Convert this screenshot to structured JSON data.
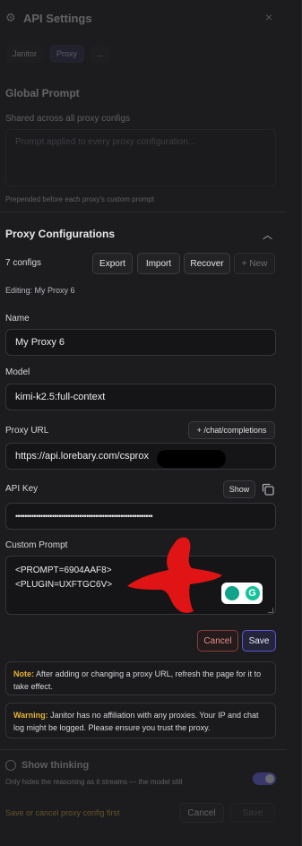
{
  "header": {
    "title": "API Settings",
    "close": "×"
  },
  "tabs": [
    {
      "label": "Janitor"
    },
    {
      "label": "Proxy"
    },
    {
      "label": "..."
    }
  ],
  "global_prompt": {
    "title": "Global Prompt",
    "subtitle": "Shared across all proxy configs",
    "placeholder": "Prompt applied to every proxy configuration...",
    "hint": "Prepended before each proxy's custom prompt"
  },
  "proxy": {
    "title": "Proxy Configurations",
    "count": "7 configs",
    "export": "Export",
    "import": "Import",
    "recover": "Recover",
    "new": "+ New",
    "editing": "Editing: My Proxy 6"
  },
  "form": {
    "name_label": "Name",
    "name_value": "My Proxy 6",
    "model_label": "Model",
    "model_value": "kimi-k2.5:full-context",
    "url_label": "Proxy URL",
    "url_suffix_button": "+ /chat/completions",
    "url_value": "https://api.lorebary.com/csprox",
    "api_key_label": "API Key",
    "show_button": "Show",
    "api_key_value": "••••••••••••••••••••••••••••••••••••••••••••••••••••••••••••",
    "custom_prompt_label": "Custom Prompt",
    "custom_prompt_line1": "<PROMPT=6904AAF8>",
    "custom_prompt_line2": "<PLUGIN=UXFTGC6V>",
    "cancel": "Cancel",
    "save": "Save"
  },
  "notes": {
    "note_label": "Note:",
    "note_text": " After adding or changing a proxy URL, refresh the page for it to take effect.",
    "warning_label": "Warning:",
    "warning_text": " Janitor has no affiliation with any proxies. Your IP and chat log might be logged. Please ensure you trust the proxy."
  },
  "footer": {
    "thinking_title": "Show thinking",
    "thinking_sub": "Only hides the reasoning as it streams — the model still",
    "status": "Save or cancel proxy config first",
    "cancel": "Cancel",
    "save": "Save"
  },
  "colors": {
    "accent": "#6f6cff",
    "warning": "#e6b233",
    "danger": "#e11b1b",
    "cancel_border": "#8b3a3a",
    "save_border": "#5b57d6"
  }
}
